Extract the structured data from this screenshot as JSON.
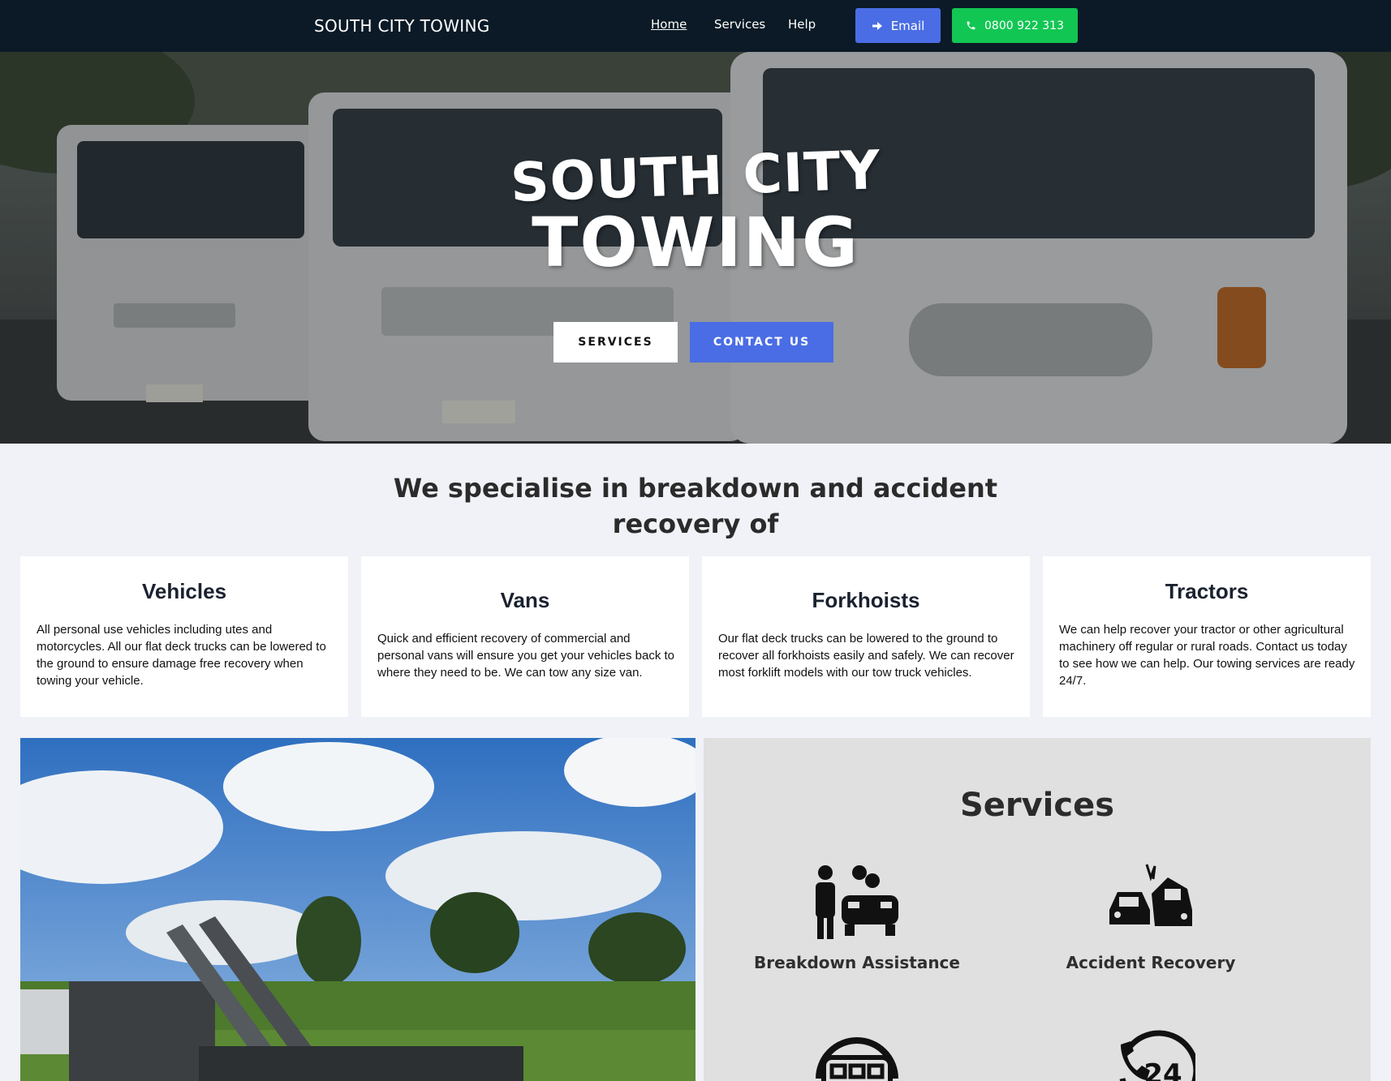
{
  "nav": {
    "brand": "SOUTH CITY TOWING",
    "links": [
      "Home",
      "Services",
      "Help"
    ],
    "email_label": "Email",
    "phone_label": "0800 922 313"
  },
  "hero": {
    "logo_line1": "SOUTH CITY",
    "logo_line2": "TOWING",
    "services_button": "SERVICES",
    "contact_button": "CONTACT US"
  },
  "specialise": {
    "title": "We specialise in breakdown and accident recovery of",
    "cards": [
      {
        "title": "Vehicles",
        "text": "All personal use vehicles including utes and motorcycles. All our flat deck trucks can be lowered to the ground to ensure damage free recovery when towing your vehicle."
      },
      {
        "title": "Vans",
        "text": "Quick and efficient recovery of commercial and personal vans will ensure you get your vehicles back to where they need to be. We can tow any size van."
      },
      {
        "title": "Forkhoists",
        "text": "Our flat deck trucks can be lowered to the ground to recover all forkhoists easily and safely. We can recover most forklift models with our tow truck vehicles."
      },
      {
        "title": "Tractors",
        "text": "We can help recover your tractor or other agricultural machinery off regular or rural roads. Contact us today to see how we can help. Our towing services are ready 24/7."
      }
    ]
  },
  "services": {
    "title": "Services",
    "items": [
      {
        "label": "Breakdown Assistance",
        "icon": "mechanic-car-icon"
      },
      {
        "label": "Accident Recovery",
        "icon": "car-crash-icon"
      },
      {
        "label": "",
        "icon": "truck-front-icon"
      },
      {
        "label": "",
        "icon": "phone-24-icon",
        "icon_text": "24"
      }
    ]
  },
  "colors": {
    "nav_bg": "#0b1a26",
    "email_button": "#4a6de5",
    "phone_button": "#12c653",
    "page_bg": "#f0f2f7",
    "services_panel_bg": "#e0e0e0"
  }
}
